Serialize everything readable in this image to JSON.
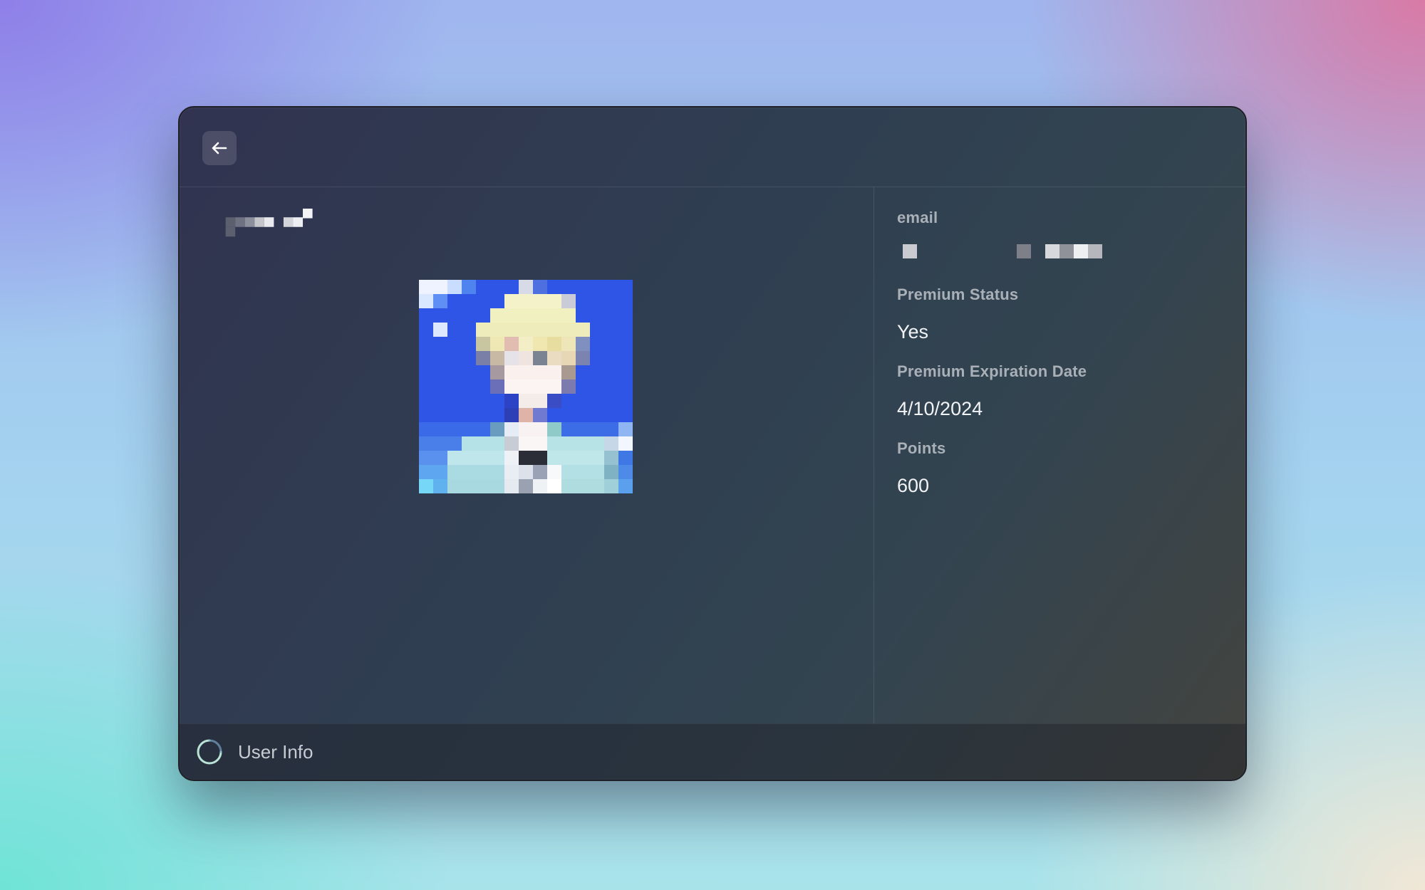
{
  "toolbar": {
    "back_icon": "arrow-left-icon"
  },
  "profile": {
    "avatar_icon": "avatar-image"
  },
  "details": [
    {
      "label": "email",
      "value": ""
    },
    {
      "label": "Premium Status",
      "value": "Yes"
    },
    {
      "label": "Premium Expiration Date",
      "value": "4/10/2024"
    },
    {
      "label": "Points",
      "value": "600"
    }
  ],
  "footer": {
    "spinner_icon": "loading-spinner-icon",
    "title": "User Info"
  },
  "colors": {
    "window_bg": "#2f3f51",
    "label": "#aab0b8",
    "value": "#f2f3f5"
  }
}
